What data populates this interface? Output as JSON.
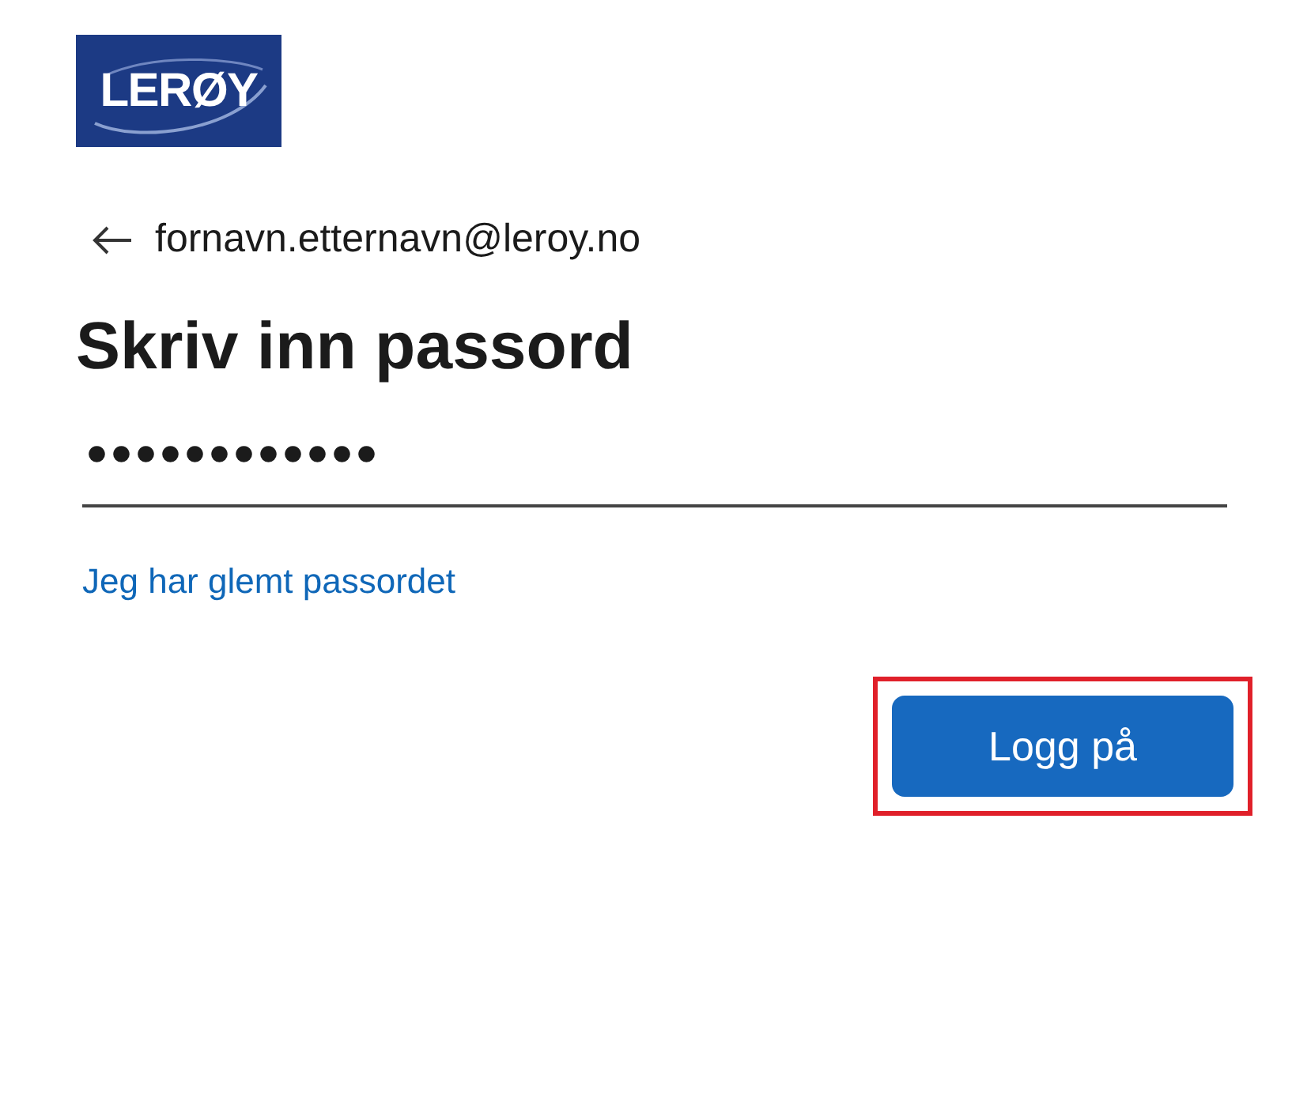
{
  "logo": {
    "text": "LERØY"
  },
  "account": {
    "email": "fornavn.etternavn@leroy.no"
  },
  "heading": "Skriv inn passord",
  "password_field": {
    "value": "●●●●●●●●●●●●"
  },
  "forgot_link": "Jeg har glemt passordet",
  "sign_in_button": {
    "label": "Logg på",
    "highlighted": true
  }
}
